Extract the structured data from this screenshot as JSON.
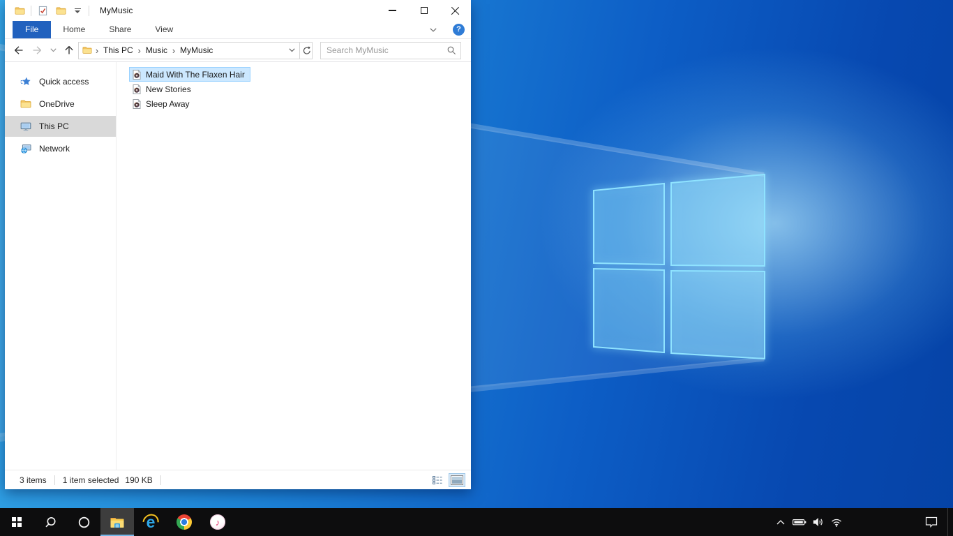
{
  "explorer": {
    "title": "MyMusic",
    "ribbon": {
      "tabs": [
        {
          "label": "File"
        },
        {
          "label": "Home"
        },
        {
          "label": "Share"
        },
        {
          "label": "View"
        }
      ],
      "active_tab": "File",
      "help_label": "?"
    },
    "navigation": {
      "breadcrumb": [
        "This PC",
        "Music",
        "MyMusic"
      ],
      "search_placeholder": "Search MyMusic"
    },
    "sidebar": {
      "items": [
        {
          "label": "Quick access",
          "icon": "star-icon",
          "selected": false
        },
        {
          "label": "OneDrive",
          "icon": "folder-icon",
          "selected": false
        },
        {
          "label": "This PC",
          "icon": "monitor-icon",
          "selected": true
        },
        {
          "label": "Network",
          "icon": "network-icon",
          "selected": false
        }
      ]
    },
    "files": {
      "items": [
        {
          "name": "Maid With The Flaxen Hair",
          "icon": "music-file-icon",
          "selected": true
        },
        {
          "name": "New Stories",
          "icon": "music-file-icon",
          "selected": false
        },
        {
          "name": "Sleep Away",
          "icon": "music-file-icon",
          "selected": false
        }
      ]
    },
    "statusbar": {
      "item_count": "3 items",
      "selection": "1 item selected",
      "selection_size": "190 KB"
    }
  },
  "taskbar": {
    "buttons": [
      "start",
      "search",
      "cortana",
      "file-explorer",
      "internet-explorer",
      "chrome",
      "itunes"
    ],
    "active_button": "file-explorer",
    "tray_icons": [
      "hidden-icons-chevron",
      "battery",
      "volume",
      "wifi",
      "action-center"
    ]
  },
  "colors": {
    "file_tab_blue": "#2161be",
    "selection_bg": "#cce8ff",
    "selection_border": "#99d1ff",
    "sidebar_selected_bg": "#d9d9d9",
    "taskbar_bg": "#0d0d0e",
    "taskbar_active_underline": "#75b6e7",
    "wallpaper_light": "#36a9e8",
    "wallpaper_dark": "#0543a6"
  }
}
